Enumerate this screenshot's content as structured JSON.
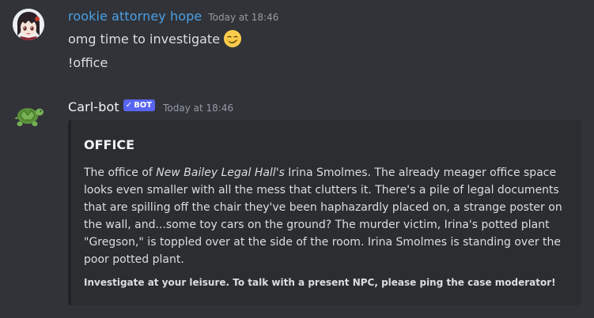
{
  "messages": [
    {
      "author": "rookie attorney hope",
      "author_color": "#4aa0e6",
      "timestamp": "Today at 18:46",
      "lines": [
        "omg time to investigate",
        "!office"
      ],
      "emoji": "smirk-face"
    },
    {
      "author": "Carl-bot",
      "author_color": "#f2f3f5",
      "badge": "BOT",
      "timestamp": "Today at 18:46",
      "embed": {
        "title": "OFFICE",
        "description": {
          "part1": "The office of ",
          "italic": "New Bailey Legal Hall's",
          "part2": " Irina Smolmes. The already meager office space looks even smaller with all the mess that clutters it. There's a pile of legal documents that are spilling off the chair they've been haphazardly placed on, a strange poster on the wall, and...some toy cars on the ground? The murder victim, Irina's potted plant \"Gregson,\" is toppled over at the side of the room. Irina Smolmes is standing over the poor potted plant."
        },
        "footer": "Investigate at your leisure. To talk with a present NPC, please ping the case moderator!"
      }
    }
  ]
}
